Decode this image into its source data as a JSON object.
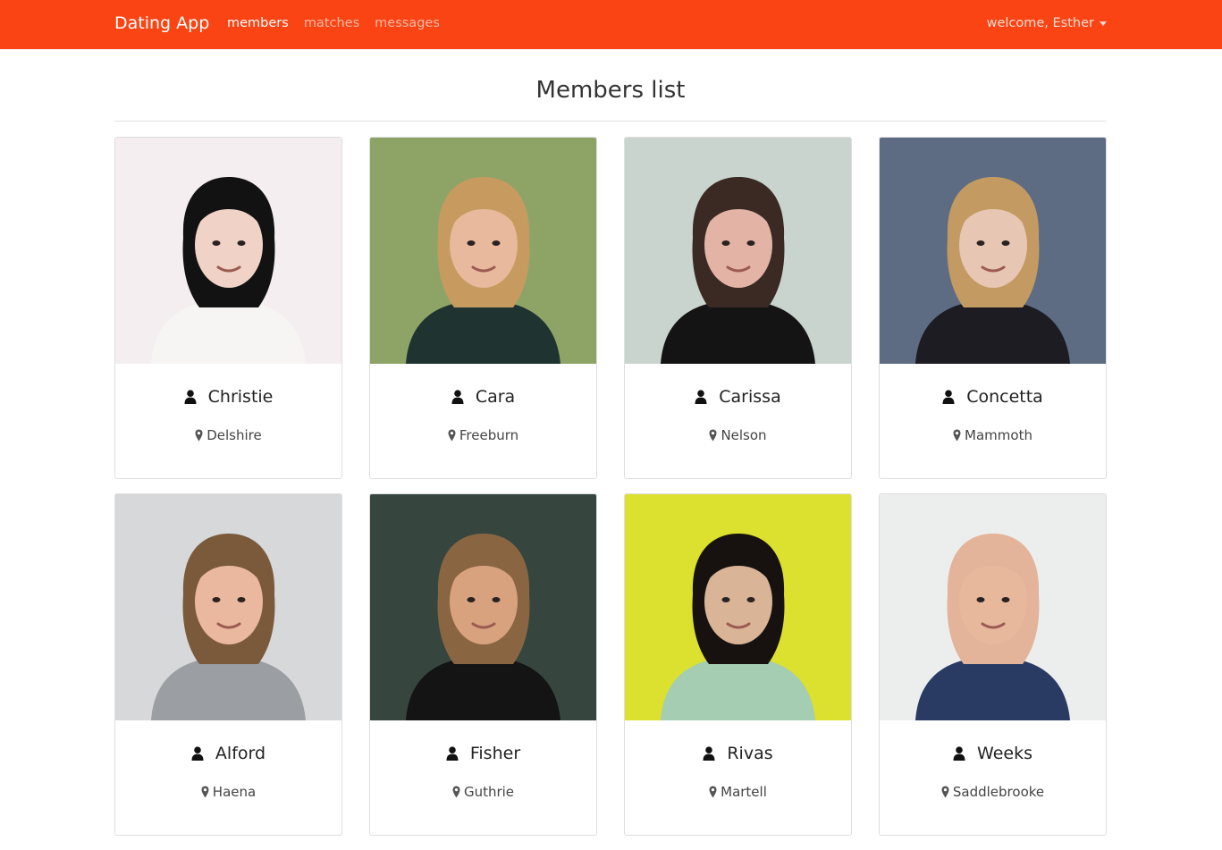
{
  "navbar": {
    "brand": "Dating App",
    "links": [
      {
        "label": "members",
        "active": true
      },
      {
        "label": "matches",
        "active": false
      },
      {
        "label": "messages",
        "active": false
      }
    ],
    "user_menu": "welcome, Esther",
    "color": "#fa4414"
  },
  "page": {
    "title": "Members list"
  },
  "members": [
    {
      "name": "Christie",
      "city": "Delshire",
      "photo": {
        "bg": "#f5eef0",
        "skin": "#f1d2c6",
        "hair": "#121212",
        "shirt": "#f7f4f4"
      }
    },
    {
      "name": "Cara",
      "city": "Freeburn",
      "photo": {
        "bg": "#8ea467",
        "skin": "#e8b99c",
        "hair": "#c79a5f",
        "shirt": "#1f3330"
      }
    },
    {
      "name": "Carissa",
      "city": "Nelson",
      "photo": {
        "bg": "#c9d4cf",
        "skin": "#e3b3a5",
        "hair": "#3b2a23",
        "shirt": "#141414"
      }
    },
    {
      "name": "Concetta",
      "city": "Mammoth",
      "photo": {
        "bg": "#5d6b83",
        "skin": "#e7c7b4",
        "hair": "#c39a62",
        "shirt": "#1c1c22"
      }
    },
    {
      "name": "Alford",
      "city": "Haena",
      "photo": {
        "bg": "#d6d8da",
        "skin": "#eab89e",
        "hair": "#7b5a3c",
        "shirt": "#9b9ea3"
      }
    },
    {
      "name": "Fisher",
      "city": "Guthrie",
      "photo": {
        "bg": "#36463f",
        "skin": "#d8a27f",
        "hair": "#8a6542",
        "shirt": "#141414"
      }
    },
    {
      "name": "Rivas",
      "city": "Martell",
      "photo": {
        "bg": "#dbe12e",
        "skin": "#d9b497",
        "hair": "#17120f",
        "shirt": "#a5cdb1"
      }
    },
    {
      "name": "Weeks",
      "city": "Saddlebrooke",
      "photo": {
        "bg": "#eceeee",
        "skin": "#e7b89c",
        "hair": "#e3b49a",
        "shirt": "#2a3b63"
      }
    }
  ]
}
